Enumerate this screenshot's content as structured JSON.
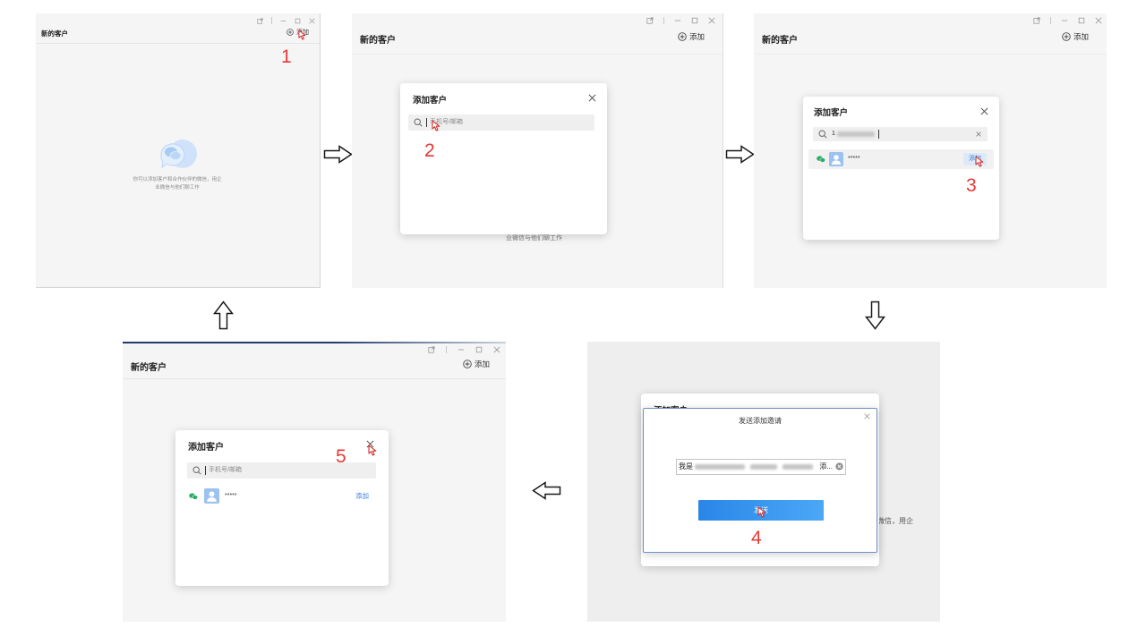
{
  "colors": {
    "step_number": "#e53935",
    "accent_blue": "#2b88ea",
    "link_blue": "#3d7fd6",
    "wechat_green": "#2aae67",
    "avatar_blue": "#9cc2ef"
  },
  "icons": {
    "add": "circle-plus-icon",
    "search": "search-icon",
    "close": "close-icon",
    "clear": "clear-circle-icon",
    "wechat": "wechat-icon",
    "avatar": "user-avatar-icon",
    "cursor": "mouse-pointer-icon",
    "empty_state": "chat-bubble-icon",
    "window": [
      "pop-out-icon",
      "minimize-icon",
      "maximize-icon",
      "close-window-icon"
    ],
    "flow_arrows": [
      "arrow-right-icon",
      "arrow-right-icon",
      "arrow-down-icon",
      "arrow-left-icon",
      "arrow-up-icon"
    ]
  },
  "panel1": {
    "step": "1",
    "title": "新的客户",
    "add_label": "添加",
    "empty_line1": "你可以添加客户和合作伙伴的微信，用企",
    "empty_line2": "业微信与他们聊工作"
  },
  "panel2": {
    "step": "2",
    "title": "新的客户",
    "add_label": "添加",
    "dialog_title": "添加客户",
    "search_placeholder": "手机号/邮箱",
    "behind_text": "业微信与他们聊工作"
  },
  "panel3": {
    "step": "3",
    "title": "新的客户",
    "add_label": "添加",
    "dialog_title": "添加客户",
    "search_value": "1",
    "result": {
      "name": "*****",
      "action": "添加"
    }
  },
  "panel4": {
    "step": "4",
    "behind_dialog_title": "添加客户",
    "dialog_title": "发送添加邀请",
    "message_prefix": "我是",
    "message_suffix": "添...",
    "send_label": "发送",
    "behind_text": "微信，用企"
  },
  "panel5": {
    "step": "5",
    "title": "新的客户",
    "add_label": "添加",
    "dialog_title": "添加客户",
    "search_placeholder": "手机号/邮箱",
    "result": {
      "name": "*****",
      "action": "添加"
    }
  }
}
